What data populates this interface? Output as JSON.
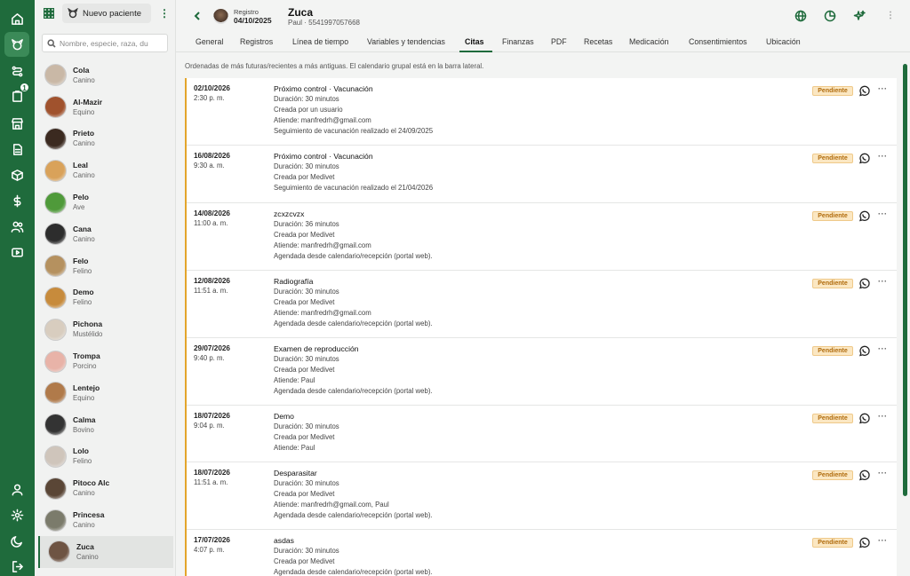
{
  "rail": {
    "icons": [
      "home-icon",
      "pet-icon",
      "route-icon",
      "clipboard-icon",
      "store-icon",
      "document-icon",
      "box-icon",
      "dollar-icon",
      "users-icon",
      "video-icon",
      "user-icon",
      "settings-icon",
      "moon-icon",
      "logout-icon"
    ],
    "badge_count": "1"
  },
  "patients": {
    "new_label": "Nuevo paciente",
    "search_placeholder": "Nombre, especie, raza, du",
    "items": [
      {
        "name": "Cola",
        "species": "Canino",
        "color": "#c9b8a6"
      },
      {
        "name": "Al-Mazir",
        "species": "Equino",
        "color": "#a0522d"
      },
      {
        "name": "Prieto",
        "species": "Canino",
        "color": "#3b2a20"
      },
      {
        "name": "Leal",
        "species": "Canino",
        "color": "#d9a25a"
      },
      {
        "name": "Pelo",
        "species": "Ave",
        "color": "#4f9a3a"
      },
      {
        "name": "Cana",
        "species": "Canino",
        "color": "#2d2d2d"
      },
      {
        "name": "Felo",
        "species": "Felino",
        "color": "#b5915f"
      },
      {
        "name": "Demo",
        "species": "Felino",
        "color": "#c78b3c"
      },
      {
        "name": "Pichona",
        "species": "Mustélido",
        "color": "#d8cdbf"
      },
      {
        "name": "Trompa",
        "species": "Porcino",
        "color": "#e8b3a8"
      },
      {
        "name": "Lentejo",
        "species": "Equino",
        "color": "#b07a4a"
      },
      {
        "name": "Calma",
        "species": "Bovino",
        "color": "#333333"
      },
      {
        "name": "Lolo",
        "species": "Felino",
        "color": "#cfc5bb"
      },
      {
        "name": "Pitoco Alc",
        "species": "Canino",
        "color": "#5a4636"
      },
      {
        "name": "Princesa",
        "species": "Canino",
        "color": "#7b7b6b"
      },
      {
        "name": "Zuca",
        "species": "Canino",
        "color": "#6e5443"
      }
    ]
  },
  "header": {
    "registro_label": "Registro",
    "registro_date": "04/10/2025",
    "name": "Zuca",
    "subtitle": "Paul · 5541997057668"
  },
  "tabs": [
    "General",
    "Registros",
    "Línea de tiempo",
    "Variables y tendencias",
    "Citas",
    "Finanzas",
    "PDF",
    "Recetas",
    "Medicación",
    "Consentimientos",
    "Ubicación"
  ],
  "active_tab": "Citas",
  "note": "Ordenadas de más futuras/recientes a más antiguas. El calendario grupal está en la barra lateral.",
  "appointments": [
    {
      "date": "02/10/2026",
      "time": "2:30 p. m.",
      "title": "Próximo control · Vacunación",
      "lines": [
        "Duración: 30 minutos",
        "Creada por un usuario",
        "Atiende: manfredrh@gmail.com",
        "Seguimiento de vacunación realizado el 24/09/2025"
      ],
      "status": "Pendiente"
    },
    {
      "date": "16/08/2026",
      "time": "9:30 a. m.",
      "title": "Próximo control · Vacunación",
      "lines": [
        "Duración: 30 minutos",
        "Creada por Medivet",
        "Seguimiento de vacunación realizado el 21/04/2026"
      ],
      "status": "Pendiente"
    },
    {
      "date": "14/08/2026",
      "time": "11:00 a. m.",
      "title": "zcxzcvzx",
      "lines": [
        "Duración: 36 minutos",
        "Creada por Medivet",
        "Atiende: manfredrh@gmail.com",
        "Agendada desde calendario/recepción (portal web)."
      ],
      "status": "Pendiente"
    },
    {
      "date": "12/08/2026",
      "time": "11:51 a. m.",
      "title": "Radiografía",
      "lines": [
        "Duración: 30 minutos",
        "Creada por Medivet",
        "Atiende: manfredrh@gmail.com",
        "Agendada desde calendario/recepción (portal web)."
      ],
      "status": "Pendiente"
    },
    {
      "date": "29/07/2026",
      "time": "9:40 p. m.",
      "title": "Examen de reproducción",
      "lines": [
        "Duración: 30 minutos",
        "Creada por Medivet",
        "Atiende: Paul",
        "Agendada desde calendario/recepción (portal web)."
      ],
      "status": "Pendiente"
    },
    {
      "date": "18/07/2026",
      "time": "9:04 p. m.",
      "title": "Demo",
      "lines": [
        "Duración: 30 minutos",
        "Creada por Medivet",
        "Atiende: Paul"
      ],
      "status": "Pendiente"
    },
    {
      "date": "18/07/2026",
      "time": "11:51 a. m.",
      "title": "Desparasitar",
      "lines": [
        "Duración: 30 minutos",
        "Creada por Medivet",
        "Atiende: manfredrh@gmail.com, Paul",
        "Agendada desde calendario/recepción (portal web)."
      ],
      "status": "Pendiente"
    },
    {
      "date": "17/07/2026",
      "time": "4:07 p. m.",
      "title": "asdas",
      "lines": [
        "Duración: 30 minutos",
        "Creada por Medivet",
        "Agendada desde calendario/recepción (portal web)."
      ],
      "status": "Pendiente"
    }
  ],
  "colors": {
    "brand": "#1f6b3c",
    "pending_bg": "#fbe7c2",
    "pending_text": "#b06b0c",
    "accent_border": "#e3a52b"
  }
}
